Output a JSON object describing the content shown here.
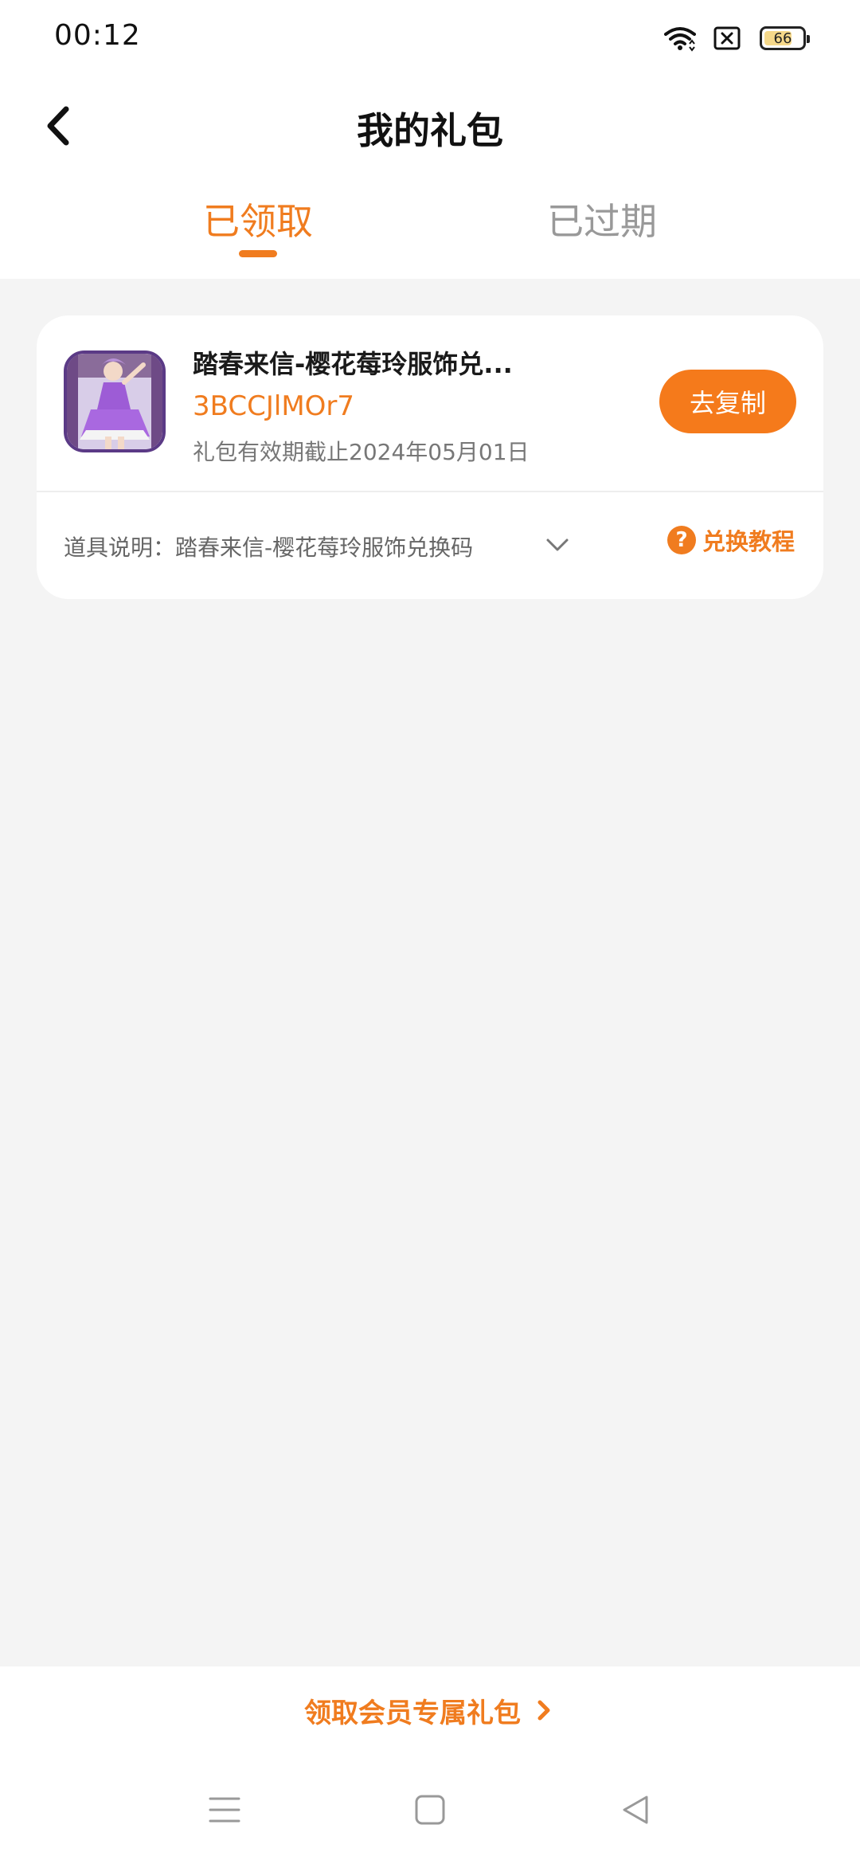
{
  "status_bar": {
    "time": "00:12",
    "battery_level": "66",
    "icons": [
      "wifi-icon",
      "sim-blocked-icon",
      "battery-icon"
    ]
  },
  "header": {
    "title": "我的礼包",
    "back_icon": "chevron-left-icon",
    "tabs": [
      {
        "label": "已领取",
        "active": true
      },
      {
        "label": "已过期",
        "active": false
      }
    ]
  },
  "gift_card": {
    "name": "踏春来信-樱花莓玲服饰兑...",
    "code": "3BCCJlMOr7",
    "expiry": "礼包有效期截止2024年05月01日",
    "copy_button": "去复制",
    "item_description": "道具说明：踏春来信-樱花莓玲服饰兑换码",
    "tutorial_link": "兑换教程",
    "help_icon_glyph": "?"
  },
  "member_link": {
    "label": "领取会员专属礼包"
  },
  "nav_bar": {
    "buttons": [
      "menu-icon",
      "home-square-icon",
      "back-triangle-icon"
    ]
  },
  "colors": {
    "accent": "#f07c1f",
    "button": "#f57a1b",
    "background": "#f4f4f4"
  }
}
